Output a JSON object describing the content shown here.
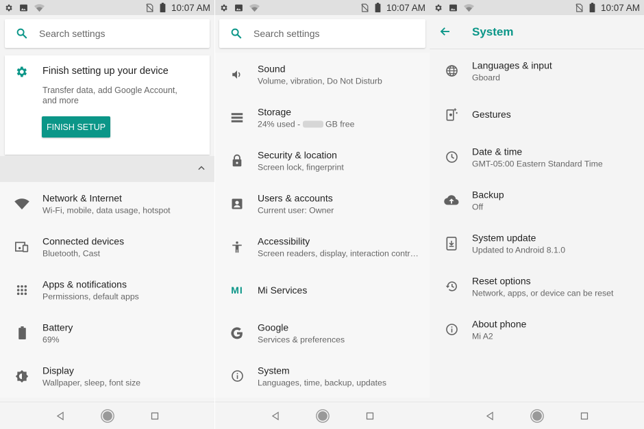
{
  "status": {
    "time": "10:07 AM"
  },
  "search": {
    "placeholder": "Search settings"
  },
  "panel1": {
    "card": {
      "title": "Finish setting up your device",
      "subtitle_line1": "Transfer data, add Google Account,",
      "subtitle_line2": "and more",
      "button": "FINISH SETUP"
    },
    "items": [
      {
        "title": "Network & Internet",
        "subtitle": "Wi-Fi, mobile, data usage, hotspot",
        "icon": "wifi-icon"
      },
      {
        "title": "Connected devices",
        "subtitle": "Bluetooth, Cast",
        "icon": "devices-icon"
      },
      {
        "title": "Apps & notifications",
        "subtitle": "Permissions, default apps",
        "icon": "apps-grid-icon"
      },
      {
        "title": "Battery",
        "subtitle": "69%",
        "icon": "battery-icon"
      },
      {
        "title": "Display",
        "subtitle": "Wallpaper, sleep, font size",
        "icon": "brightness-icon"
      }
    ]
  },
  "panel2": {
    "items": [
      {
        "title": "Sound",
        "subtitle": "Volume, vibration, Do Not Disturb",
        "icon": "volume-icon"
      },
      {
        "title": "Storage",
        "subtitle_prefix": "24% used - ",
        "subtitle_suffix": " GB free",
        "icon": "storage-icon"
      },
      {
        "title": "Security & location",
        "subtitle": "Screen lock, fingerprint",
        "icon": "lock-icon"
      },
      {
        "title": "Users & accounts",
        "subtitle": "Current user: Owner",
        "icon": "account-box-icon"
      },
      {
        "title": "Accessibility",
        "subtitle": "Screen readers, display, interaction contr…",
        "icon": "accessibility-icon"
      },
      {
        "title": "Mi Services",
        "icon": "mi-logo-icon",
        "logo_text": "MI"
      },
      {
        "title": "Google",
        "subtitle": "Services & preferences",
        "icon": "google-g-icon"
      },
      {
        "title": "System",
        "subtitle": "Languages, time, backup, updates",
        "icon": "info-icon"
      }
    ]
  },
  "panel3": {
    "title": "System",
    "items": [
      {
        "title": "Languages & input",
        "subtitle": "Gboard",
        "icon": "globe-icon"
      },
      {
        "title": "Gestures",
        "icon": "gestures-icon"
      },
      {
        "title": "Date & time",
        "subtitle": "GMT-05:00 Eastern Standard Time",
        "icon": "clock-icon"
      },
      {
        "title": "Backup",
        "subtitle": "Off",
        "icon": "cloud-upload-icon"
      },
      {
        "title": "System update",
        "subtitle": "Updated to Android 8.1.0",
        "icon": "system-update-icon"
      },
      {
        "title": "Reset options",
        "subtitle": "Network, apps, or device can be reset",
        "icon": "restore-icon"
      },
      {
        "title": "About phone",
        "subtitle": "Mi A2",
        "icon": "info-icon"
      }
    ]
  },
  "colors": {
    "accent": "#0b9688",
    "icon": "#616161",
    "text": "#222222",
    "secondary": "#666666"
  }
}
